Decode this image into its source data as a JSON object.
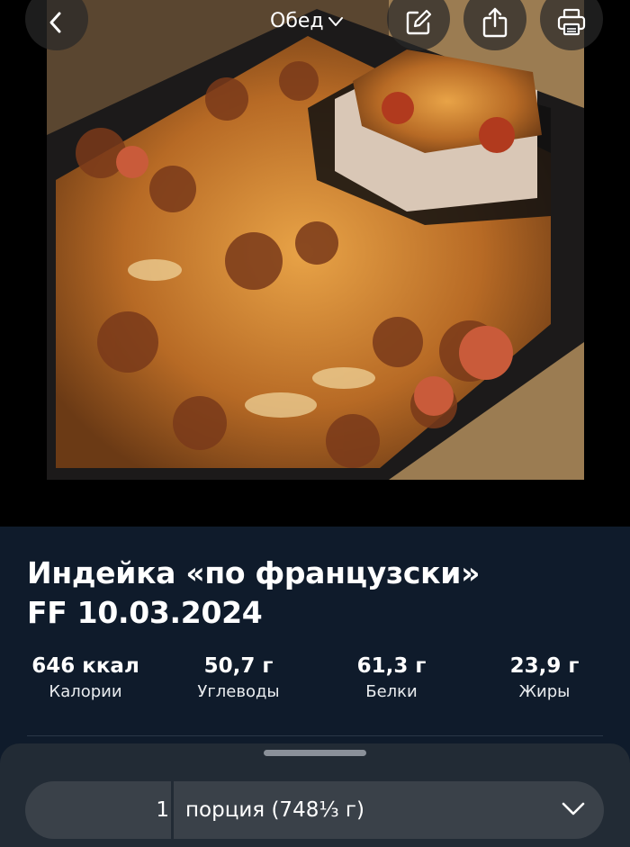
{
  "header": {
    "meal": "Обед",
    "back_icon": "chevron-left-icon",
    "edit_icon": "edit-icon",
    "share_icon": "share-icon",
    "print_icon": "print-icon"
  },
  "recipe": {
    "title_line1": "Индейка «по французски»",
    "title_line2": "FF 10.03.2024"
  },
  "nutrition": [
    {
      "value": "646 ккал",
      "label": "Калории"
    },
    {
      "value": "50,7 г",
      "label": "Углеводы"
    },
    {
      "value": "61,3 г",
      "label": "Белки"
    },
    {
      "value": "23,9 г",
      "label": "Жиры"
    }
  ],
  "serving": {
    "quantity": "1",
    "unit": "порция (748⅓ г)"
  },
  "colors": {
    "background": "#0f1b2b",
    "sheet": "#222b35",
    "field": "#3a4149"
  }
}
